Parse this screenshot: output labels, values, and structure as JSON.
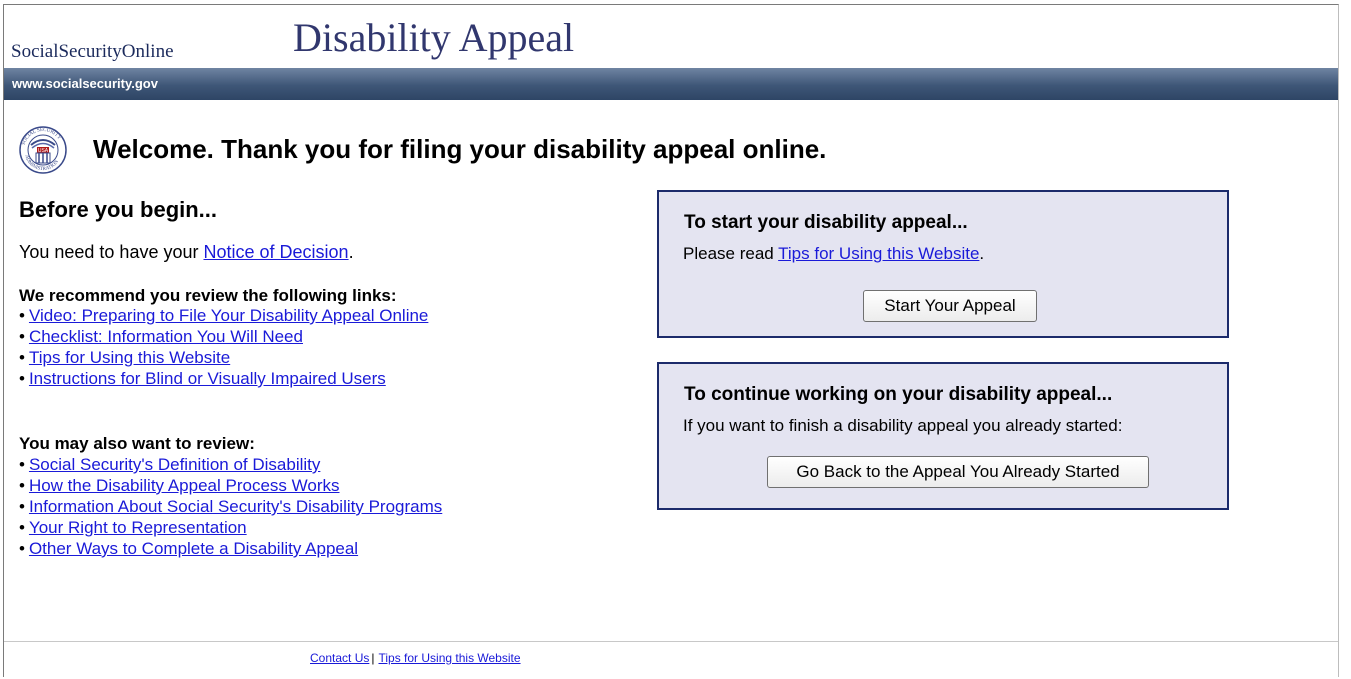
{
  "header": {
    "site_name": "SocialSecurityOnline",
    "page_heading": "Disability Appeal",
    "url_text": "www.socialsecurity.gov"
  },
  "seal": {
    "top_text": "SOCIAL SECURITY",
    "bottom_text": "ADMINISTRATION",
    "badge": "USA"
  },
  "welcome": "Welcome. Thank you for filing your disability appeal online.",
  "before": {
    "heading": "Before you begin...",
    "need_prefix": "You need to have your ",
    "need_link": "Notice of Decision",
    "need_suffix": "."
  },
  "recommend": {
    "heading": "We recommend you review the following links:",
    "links": [
      "Video: Preparing to File Your Disability Appeal Online",
      "Checklist: Information You Will Need",
      "Tips for Using this Website",
      "Instructions for Blind or Visually Impaired Users"
    ]
  },
  "also": {
    "heading": "You may also want to review:",
    "links": [
      "Social Security's Definition of Disability",
      "How the Disability Appeal Process Works",
      "Information About Social Security's Disability Programs",
      "Your Right to Representation",
      "Other Ways to Complete a Disability Appeal"
    ]
  },
  "start_box": {
    "title": "To start your disability appeal...",
    "text_prefix": "Please read ",
    "text_link": "Tips for Using this Website",
    "text_suffix": ".",
    "button": "Start Your Appeal"
  },
  "continue_box": {
    "title": "To continue working on your disability appeal...",
    "text": "If you want to finish a disability appeal you already started:",
    "button": "Go Back to the Appeal You Already Started"
  },
  "footer": {
    "contact": "Contact Us",
    "separator": "|",
    "tips": "Tips for Using this Website"
  },
  "colors": {
    "heading_navy": "#31376e",
    "box_bg": "#e4e4f1",
    "box_border": "#1c2b6b",
    "link_blue": "#1a1ad8",
    "urlbar": "#3e5677"
  }
}
